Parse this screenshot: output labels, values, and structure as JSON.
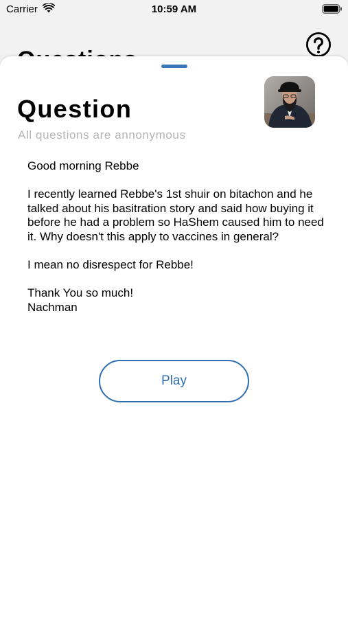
{
  "status_bar": {
    "carrier": "Carrier",
    "time": "10:59 AM",
    "wifi_icon": "wifi-icon",
    "battery_icon": "battery-icon"
  },
  "background_screen": {
    "title": "Questions",
    "help_icon": "question-circle-icon"
  },
  "sheet": {
    "title": "Question",
    "subtitle": "All questions are annonymous",
    "avatar": "rabbi-avatar",
    "question": {
      "greeting": "Good morning Rebbe",
      "paragraph1": "I recently learned Rebbe's 1st shuir on bitachon and he talked about his basitration story and said how buying it before he had a problem so HaShem caused him to need it. Why doesn't this apply to vaccines in general?",
      "paragraph2": "I mean no disrespect for Rebbe!",
      "closing": "Thank You so much!",
      "signature": "Nachman"
    },
    "play_label": "Play"
  },
  "colors": {
    "accent": "#2f6eb0",
    "subtitle_gray": "#b4b4b4",
    "background": "#f2f2f2",
    "sheet": "#ffffff"
  }
}
